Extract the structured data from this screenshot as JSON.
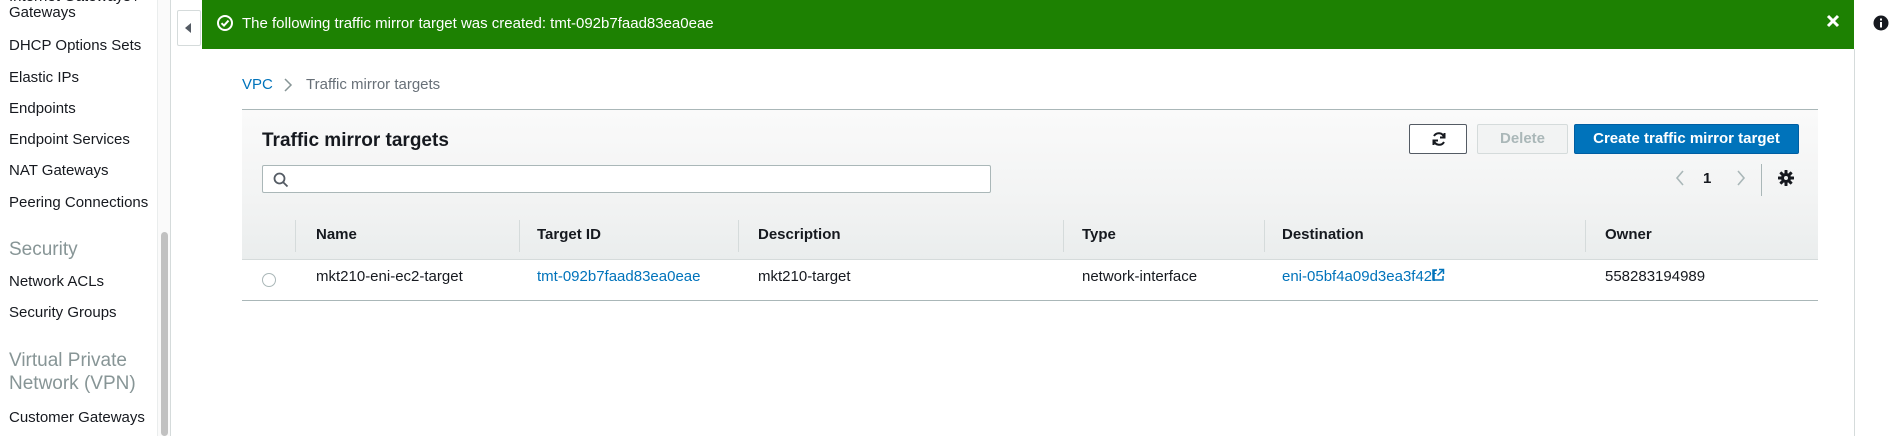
{
  "sidebar": {
    "items_top": [
      "Gateways",
      "DHCP Options Sets",
      "Elastic IPs",
      "Endpoints",
      "Endpoint Services",
      "NAT Gateways",
      "Peering Connections"
    ],
    "security_heading": "Security",
    "security_items": [
      "Network ACLs",
      "Security Groups"
    ],
    "vpn_heading_line1": "Virtual Private",
    "vpn_heading_line2": "Network (VPN)",
    "vpn_items": [
      "Customer Gateways"
    ]
  },
  "flash": {
    "message": "The following traffic mirror target was created: tmt-092b7faad83ea0eae",
    "icon": "check-circle-icon",
    "color": "#1d8102"
  },
  "breadcrumb": {
    "root": "VPC",
    "current": "Traffic mirror targets"
  },
  "panel": {
    "title": "Traffic mirror targets",
    "delete_label": "Delete",
    "create_label": "Create traffic mirror target",
    "search_value": "",
    "page_number": "1"
  },
  "table": {
    "columns": [
      "Name",
      "Target ID",
      "Description",
      "Type",
      "Destination",
      "Owner"
    ],
    "rows": [
      {
        "name": "mkt210-eni-ec2-target",
        "target_id": "tmt-092b7faad83ea0eae",
        "description": "mkt210-target",
        "type": "network-interface",
        "destination": "eni-05bf4a09d3ea3f42f",
        "owner": "558283194989"
      }
    ]
  },
  "colors": {
    "primary_button": "#0073bb",
    "link": "#0073bb",
    "success": "#1d8102"
  }
}
